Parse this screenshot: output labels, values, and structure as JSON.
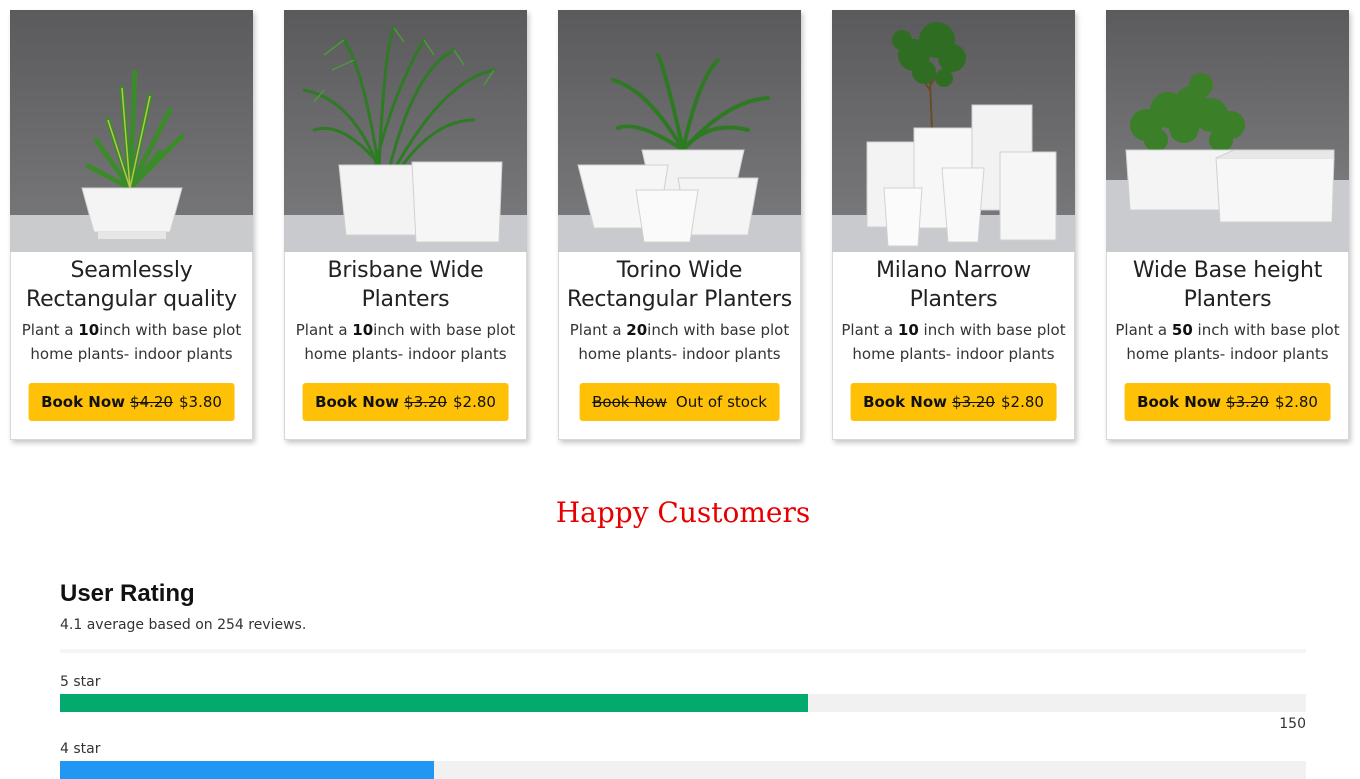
{
  "products": [
    {
      "title": "Seamlessly Rectangular quality",
      "desc_before": "Plant a ",
      "size": "10",
      "desc_after": "inch with base plot home plants- indoor plants",
      "button_label": "Book Now",
      "old_price": "$4.20",
      "new_price": "$3.80",
      "image_icon": "plant-pot-agave-image",
      "available": true
    },
    {
      "title": "Brisbane Wide Planters",
      "desc_before": "Plant a ",
      "size": "10",
      "desc_after": "inch with base plot home plants- indoor plants",
      "button_label": "Book Now",
      "old_price": "$3.20",
      "new_price": "$2.80",
      "image_icon": "palm-square-planters-image",
      "available": true
    },
    {
      "title": "Torino Wide Rectangular Planters",
      "desc_before": "Plant a ",
      "size": "20",
      "desc_after": "inch with base plot home plants- indoor plants",
      "button_label": "Book Now",
      "stock_label": "Out of stock",
      "image_icon": "tapered-planters-image",
      "available": false
    },
    {
      "title": "Milano Narrow Planters",
      "desc_before": "Plant a ",
      "size": "10",
      "desc_after": " inch with base plot home plants- indoor plants",
      "button_label": "Book Now",
      "old_price": "$3.20",
      "new_price": "$2.80",
      "image_icon": "tall-planters-image",
      "available": true
    },
    {
      "title": "Wide Base height Planters",
      "desc_before": "Plant a ",
      "size": "50",
      "desc_after": " inch with base plot home plants- indoor plants",
      "button_label": "Book Now",
      "old_price": "$3.20",
      "new_price": "$2.80",
      "image_icon": "trough-planters-image",
      "available": true
    }
  ],
  "happy_title": "Happy Customers",
  "rating": {
    "heading": "User Rating",
    "summary": "4.1 average based on 254 reviews.",
    "rows": [
      {
        "label": "5 star",
        "count": "150",
        "fraction": 0.6,
        "color": "#04aa6d"
      },
      {
        "label": "4 star",
        "fraction": 0.3,
        "color": "#2196f3"
      }
    ]
  },
  "colors": {
    "button": "#ffc107",
    "happy_title": "#e60000",
    "five_star_bar": "#04aa6d",
    "four_star_bar": "#2196f3"
  }
}
